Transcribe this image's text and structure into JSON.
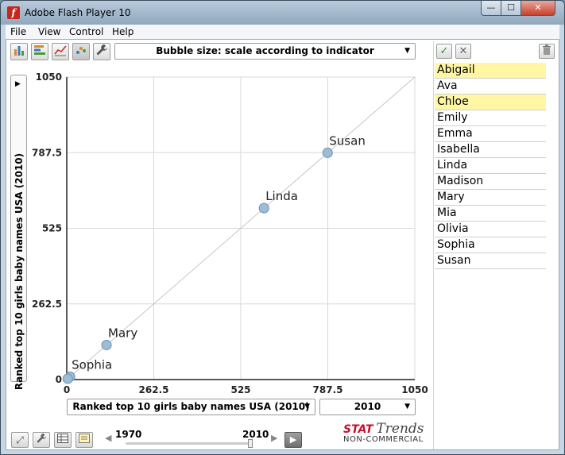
{
  "window": {
    "title": "Adobe Flash Player 10",
    "min_glyph": "—",
    "max_glyph": "☐",
    "close_glyph": "✕"
  },
  "menu": [
    "File",
    "View",
    "Control",
    "Help"
  ],
  "toolbar": {
    "icons": [
      "bar-chart-icon",
      "horizontal-bar-icon",
      "line-chart-icon",
      "scatter-chart-icon",
      "wrench-icon"
    ],
    "bubble_select": "Bubble size: scale according to indicator"
  },
  "y_axis": {
    "label": "Ranked top 10 girls baby names USA (2010)"
  },
  "x_axis": {
    "select_label": "Ranked top 10 girls baby names USA  (2010)",
    "year_select": "2010"
  },
  "chart_data": {
    "type": "scatter",
    "xlabel": "Ranked top 10 girls baby names USA  (2010)",
    "ylabel": "Ranked top 10 girls baby names USA (2010)",
    "xlim": [
      0,
      1050
    ],
    "ylim": [
      0,
      1050
    ],
    "x_ticks": [
      "0",
      "262.5",
      "525",
      "787.5",
      "1050"
    ],
    "y_ticks": [
      "0",
      "262.5",
      "525",
      "787.5",
      "1050"
    ],
    "grid": true,
    "diagonal_reference_line": true,
    "points": [
      {
        "label": "Susan",
        "x": 787,
        "y": 787
      },
      {
        "label": "Linda",
        "x": 595,
        "y": 595
      },
      {
        "label": "Mary",
        "x": 120,
        "y": 120
      },
      {
        "label": "Sophia",
        "x": 10,
        "y": 10
      },
      {
        "label": "",
        "x": 3,
        "y": 3
      }
    ],
    "point_color": "#9dbcd6"
  },
  "list": {
    "items": [
      {
        "label": "Abigail",
        "selected": true
      },
      {
        "label": "Ava",
        "selected": false
      },
      {
        "label": "Chloe",
        "selected": true
      },
      {
        "label": "Emily",
        "selected": false
      },
      {
        "label": "Emma",
        "selected": false
      },
      {
        "label": "Isabella",
        "selected": false
      },
      {
        "label": "Linda",
        "selected": false
      },
      {
        "label": "Madison",
        "selected": false
      },
      {
        "label": "Mary",
        "selected": false
      },
      {
        "label": "Mia",
        "selected": false
      },
      {
        "label": "Olivia",
        "selected": false
      },
      {
        "label": "Sophia",
        "selected": false
      },
      {
        "label": "Susan",
        "selected": false
      }
    ]
  },
  "timeline": {
    "start": "1970",
    "end": "2010",
    "position": 1.0
  },
  "brand": {
    "stat": "STAT",
    "trends": "Trends",
    "sub": "NON-COMMERCIAL"
  },
  "colors": {
    "selected_highlight": "#fff7a3",
    "accept": "#2e8b2e",
    "reject": "#666666"
  }
}
